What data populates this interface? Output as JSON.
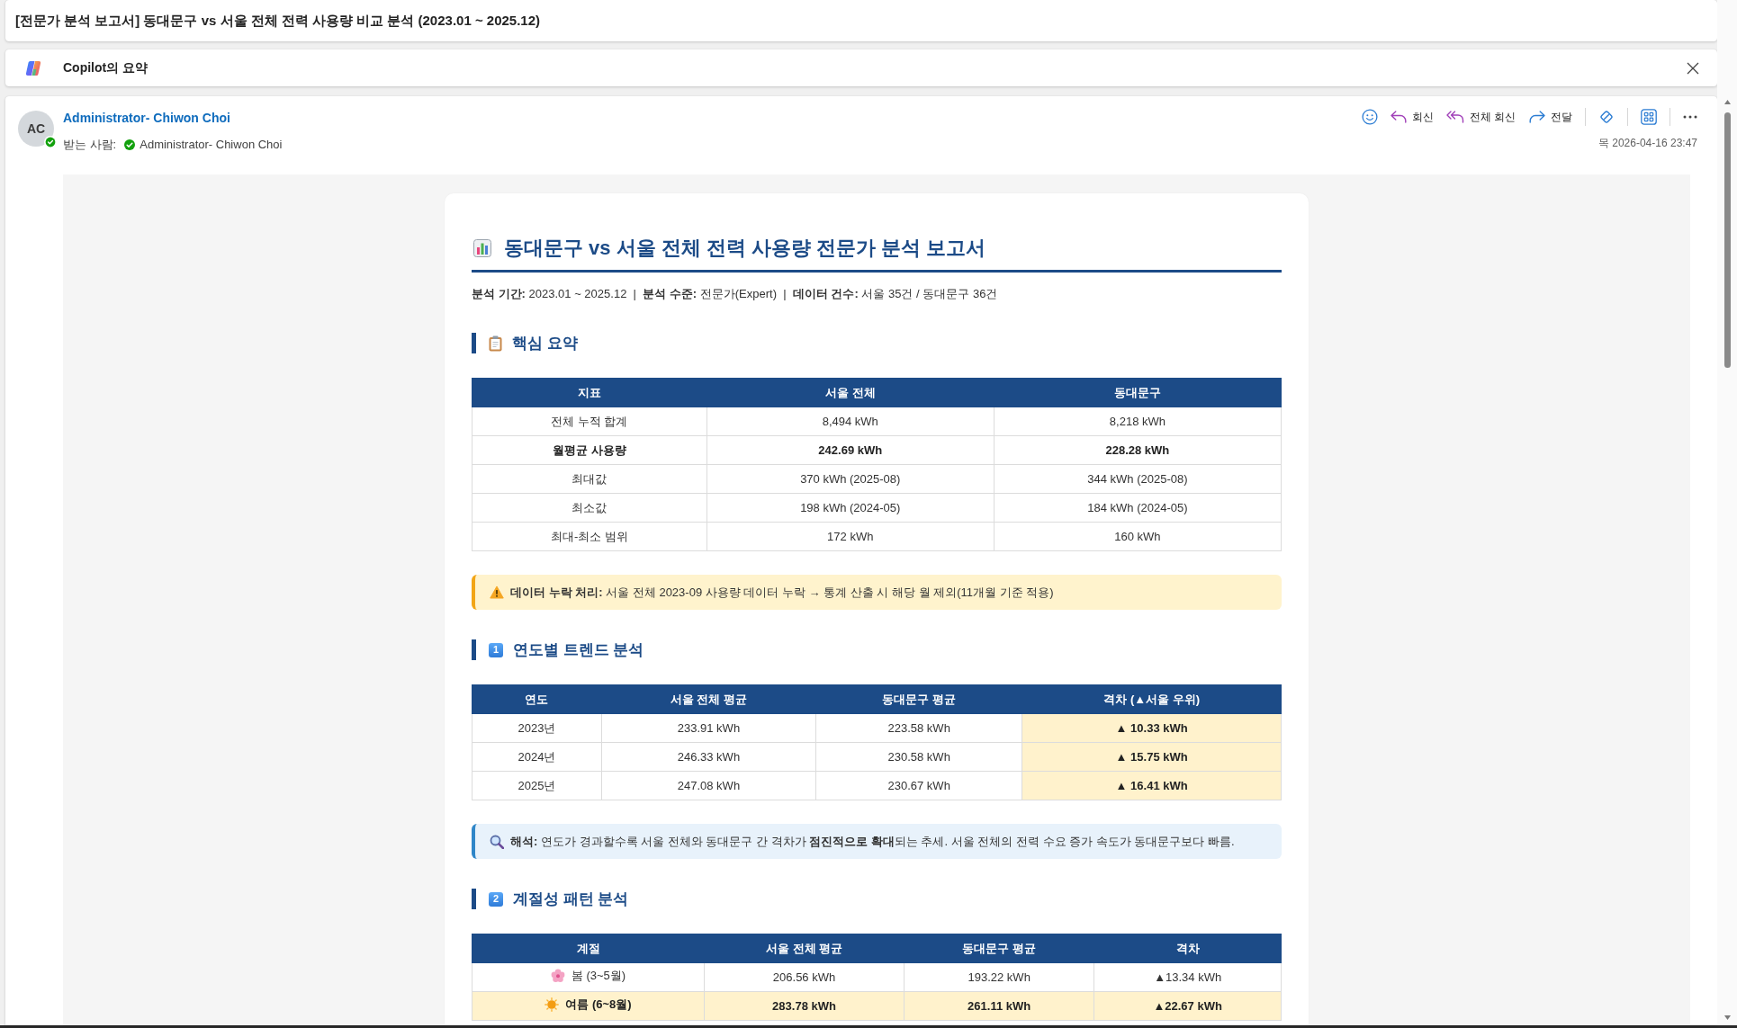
{
  "window": {
    "title": "[전문가 분석 보고서] 동대문구 vs 서울 전체 전력 사용량 비교 분석 (2023.01 ~ 2025.12)"
  },
  "copilot_bar": {
    "label": "Copilot의 요약"
  },
  "message": {
    "sender": {
      "initials": "AC",
      "name": "Administrator- Chiwon Choi",
      "available": true
    },
    "recipients_label": "받는 사람:",
    "recipients": [
      {
        "name": "Administrator- Chiwon Choi",
        "available": true
      }
    ],
    "actions": [
      {
        "kind": "reply",
        "label": "회신"
      },
      {
        "kind": "reply_all",
        "label": "전체 회신"
      },
      {
        "kind": "forward",
        "label": "전달"
      }
    ],
    "date": "목 2026-04-16 23:47"
  },
  "report": {
    "title": "동대문구 vs 서울 전체 전력 사용량 전문가 분석 보고서",
    "meta": "**분석 기간:** 2023.01 ~ 2025.12  |  **분석 수준:** 전문가(Expert)  |  **데이터 건수:** 서울 35건 / 동대문구 36건",
    "sections": [
      {
        "kind": "summary",
        "heading": "핵심 요약",
        "table": {
          "columns": [
            {
              "label": "지표"
            },
            {
              "label": "서울 전체"
            },
            {
              "label": "동대문구"
            }
          ],
          "rows": [
            {
              "cells": [
                "전체 누적 합계",
                "8,494 kWh",
                "8,218 kWh"
              ],
              "bold": false
            },
            {
              "cells": [
                "월평균 사용량",
                "242.69 kWh",
                "228.28 kWh"
              ],
              "bold": true
            },
            {
              "cells": [
                "최대값",
                "370 kWh (2025-08)",
                "344 kWh (2025-08)"
              ],
              "bold": false
            },
            {
              "cells": [
                "최소값",
                "198 kWh (2024-05)",
                "184 kWh (2024-05)"
              ],
              "bold": false
            },
            {
              "cells": [
                "최대-최소 범위",
                "172 kWh",
                "160 kWh"
              ],
              "bold": false
            }
          ]
        },
        "callout": {
          "kind": "warning",
          "text": "**데이터 누락 처리:** 서울 전체 2023-09 사용량 데이터 누락 → 통계 산출 시 해당 월 제외(11개월 기준 적용)"
        }
      },
      {
        "kind": "numbered",
        "index": "1",
        "heading": "연도별 트렌드 분석",
        "table": {
          "columns": [
            {
              "label": "연도",
              "highlighted": false
            },
            {
              "label": "서울 전체 평균",
              "highlighted": false
            },
            {
              "label": "동대문구 평균",
              "highlighted": false
            },
            {
              "label": "격차 (▲서울 우위)",
              "highlighted": true
            }
          ],
          "rows": [
            {
              "cells": [
                "2023년",
                "233.91 kWh",
                "223.58 kWh",
                "▲ 10.33 kWh"
              ]
            },
            {
              "cells": [
                "2024년",
                "246.33 kWh",
                "230.58 kWh",
                "▲ 15.75 kWh"
              ]
            },
            {
              "cells": [
                "2025년",
                "247.08 kWh",
                "230.67 kWh",
                "▲ 16.41 kWh"
              ]
            }
          ]
        },
        "callout": {
          "kind": "info",
          "text": "**해석:** 연도가 경과할수록 서울 전체와 동대문구 간 격차가 **점진적으로 확대**되는 추세. 서울 전체의 전력 수요 증가 속도가 동대문구보다 빠름."
        }
      },
      {
        "kind": "numbered",
        "index": "2",
        "heading": "계절성 패턴 분석",
        "table": {
          "columns": [
            {
              "label": "계절"
            },
            {
              "label": "서울 전체 평균"
            },
            {
              "label": "동대문구 평균"
            },
            {
              "label": "격차"
            }
          ],
          "rows": [
            {
              "kind": "spring",
              "cells": [
                "봄 (3~5월)",
                "206.56 kWh",
                "193.22 kWh",
                "▲13.34 kWh"
              ],
              "highlighted": false
            },
            {
              "kind": "summer",
              "cells": [
                "여름 (6~8월)",
                "283.78 kWh",
                "261.11 kWh",
                "▲22.67 kWh"
              ],
              "highlighted": true
            }
          ]
        }
      }
    ]
  }
}
